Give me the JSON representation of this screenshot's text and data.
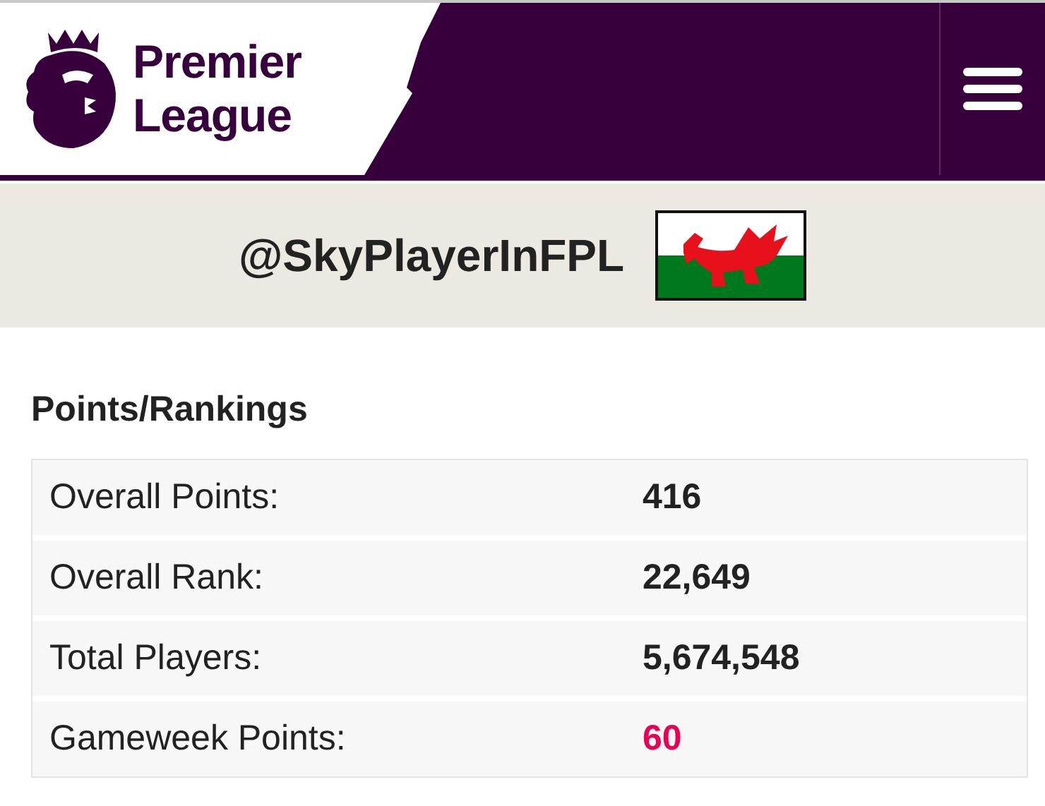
{
  "header": {
    "brand_line_1": "Premier",
    "brand_line_2": "League"
  },
  "profile": {
    "username": "@SkyPlayerInFPL"
  },
  "section": {
    "title": "Points/Rankings"
  },
  "stats": [
    {
      "label": "Overall Points:",
      "value": "416",
      "color": "#222222"
    },
    {
      "label": "Overall Rank:",
      "value": "22,649",
      "color": "#222222"
    },
    {
      "label": "Total Players:",
      "value": "5,674,548",
      "color": "#222222"
    },
    {
      "label": "Gameweek Points:",
      "value": "60",
      "color": "#e90052"
    }
  ]
}
